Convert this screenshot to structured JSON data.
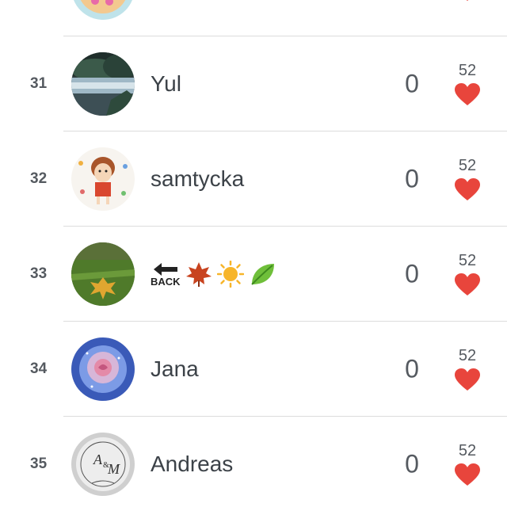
{
  "rows": [
    {
      "rank": "",
      "name": "",
      "score": "",
      "likes": "",
      "avatar": "partial-peach-avatar"
    },
    {
      "rank": "31",
      "name": "Yul",
      "score": "0",
      "likes": "52",
      "avatar": "lake-landscape"
    },
    {
      "rank": "32",
      "name": "samtycka",
      "score": "0",
      "likes": "52",
      "avatar": "cartoon-girl"
    },
    {
      "rank": "33",
      "name": "",
      "name_emojis": [
        "back-arrow-emoji",
        "maple-leaf-emoji",
        "sun-emoji",
        "leaf-emoji"
      ],
      "back_label": "BACK",
      "score": "0",
      "likes": "52",
      "avatar": "autumn-leaf-grass"
    },
    {
      "rank": "34",
      "name": "Jana",
      "score": "0",
      "likes": "52",
      "avatar": "blue-rose"
    },
    {
      "rank": "35",
      "name": "Andreas",
      "score": "0",
      "likes": "52",
      "avatar": "monogram-a-and-m"
    }
  ],
  "colors": {
    "heart": "#e8453c",
    "text": "#3c4248",
    "muted": "#555a60",
    "divider": "#dcdcdc"
  }
}
